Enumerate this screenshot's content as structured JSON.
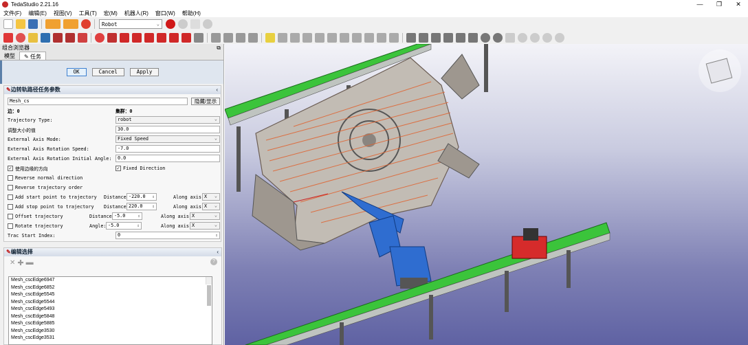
{
  "app": {
    "title": "TedaStudio 2.21.16"
  },
  "menu": [
    "文件(F)",
    "编辑(E)",
    "视图(V)",
    "工具(T)",
    "宏(M)",
    "机器人(R)",
    "窗口(W)",
    "帮助(H)"
  ],
  "toolbar": {
    "workbench": "Robot"
  },
  "panel": {
    "title": "组合浏览器",
    "tabs": [
      "模型",
      "任务"
    ],
    "buttons": {
      "ok": "OK",
      "cancel": "Cancel",
      "apply": "Apply"
    },
    "section_title": "边转轨路径任务参数",
    "mesh_name": "Mesh_cs",
    "hide_show": "隐藏/显示",
    "edge_count": "边：0",
    "cluster_count": "集群：0",
    "traj_type_label": "Trajectory Type:",
    "traj_type": "robot",
    "resize_label": "调整大小的值",
    "resize_value": "30.0",
    "ext_mode_label": "External Axis Mode:",
    "ext_mode": "Fixed Speed",
    "ext_speed_label": "External Axis Rotation Speed:",
    "ext_speed": "-7.0",
    "ext_angle_label": "External Axis Rotation Initial Angle:",
    "ext_angle": "0.0",
    "use_edge_dir": "使用边缘的方向",
    "fixed_dir": "Fixed Direction",
    "rev_normal": "Reverse normal direction",
    "rev_order": "Reverse trajectory order",
    "add_start": "Add start point to trajectory",
    "dist_label": "Distance:",
    "start_dist": "-220.0",
    "along_label": "Along axis:",
    "start_axis": "X",
    "add_stop": "Add stop point to trajectory",
    "stop_dist": "220.0",
    "stop_axis": "X",
    "offset": "Offset trajectory",
    "offset_dist": "-5.0",
    "offset_axis": "X",
    "rotate": "Rotate trajectory",
    "angle_label": "Angle:",
    "rotate_angle": "-5.0",
    "rotate_axis": "X",
    "trac_start_label": "Trac Start Index:",
    "trac_start": "0",
    "edit_title": "编辑选择",
    "edges": [
      "Mesh_cscEdge6947",
      "Mesh_cscEdge6852",
      "Mesh_cscEdge5545",
      "Mesh_cscEdge5544",
      "Mesh_cscEdge5493",
      "Mesh_cscEdge5848",
      "Mesh_cscEdge5885",
      "Mesh_cscEdge3530",
      "Mesh_cscEdge3531"
    ]
  }
}
